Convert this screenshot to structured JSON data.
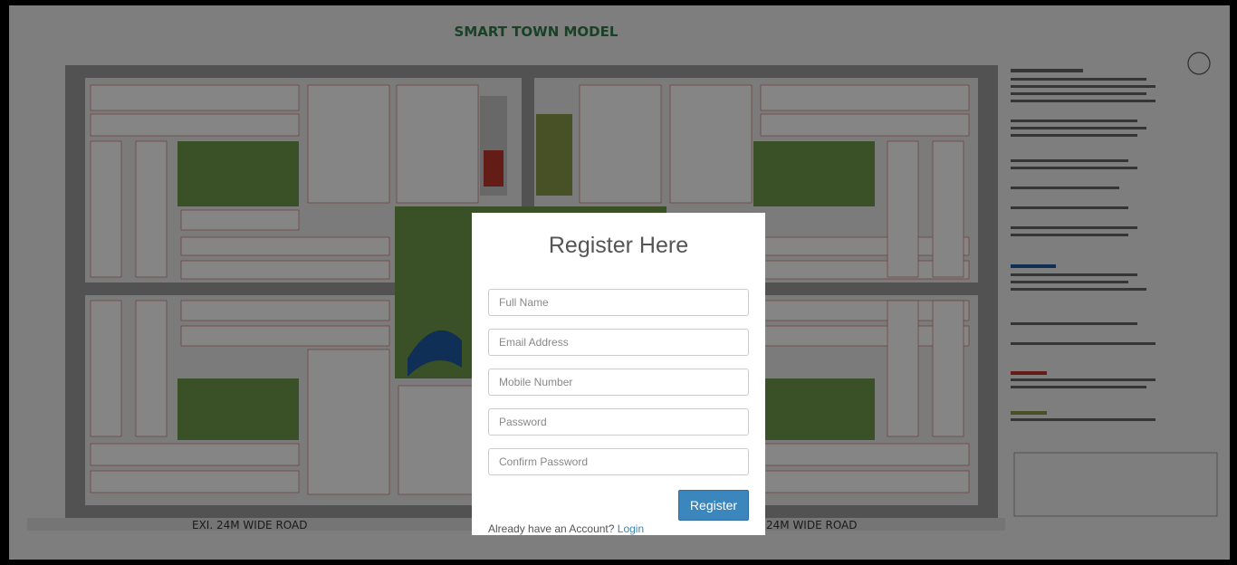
{
  "background_map": {
    "title": "SMART TOWN MODEL",
    "road_label_left": "EXI. 24M WIDE ROAD",
    "road_label_right": "24M WIDE ROAD",
    "colors": {
      "road": "#a8a8a8",
      "plot_fill": "#ffffff",
      "plot_line": "#d06060",
      "park_green": "#6f9a4a",
      "water_blue": "#1f5aa8",
      "title_green": "#2e7d4a"
    }
  },
  "modal": {
    "title": "Register Here",
    "fields": {
      "full_name": {
        "placeholder": "Full Name",
        "value": ""
      },
      "email": {
        "placeholder": "Email Address",
        "value": ""
      },
      "mobile": {
        "placeholder": "Mobile Number",
        "value": ""
      },
      "password": {
        "placeholder": "Password",
        "value": ""
      },
      "confirm_password": {
        "placeholder": "Confirm Password",
        "value": ""
      }
    },
    "register_button_label": "Register",
    "login_prompt": "Already have an Account?",
    "login_link_label": "Login",
    "accent_color": "#3a86bd"
  }
}
